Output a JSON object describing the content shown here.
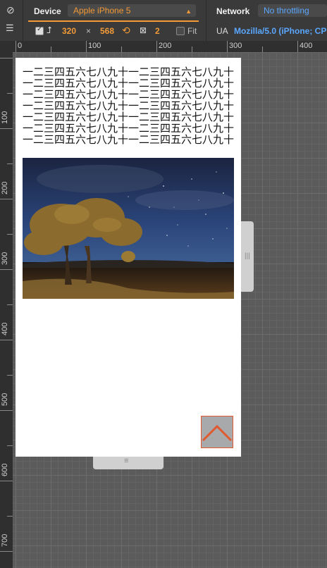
{
  "toolbar": {
    "device_label": "Device",
    "device_value": "Apple iPhone 5",
    "network_label": "Network",
    "network_value": "No throttling",
    "width": "320",
    "times": "×",
    "height": "568",
    "dpr": "2",
    "fit_label": "Fit",
    "ua_label": "UA",
    "ua_value": "Mozilla/5.0 (iPhone; CP"
  },
  "ruler": {
    "top": [
      "0",
      "100",
      "200",
      "300",
      "400"
    ],
    "left": [
      "100",
      "200",
      "300",
      "400",
      "500",
      "600",
      "700"
    ]
  },
  "page": {
    "text_lines": [
      "一二三四五六七八九十一二三四五六七八九十",
      "一二三四五六七八九十一二三四五六七八九十",
      "一二三四五六七八九十一二三四五六七八九十",
      "一二三四五六七八九十一二三四五六七八九十",
      "一二三四五六七八九十一二三四五六七八九十",
      "一二三四五六七八九十一二三四五六七八九十",
      "一二三四五六七八九十一二三四五六七八九十"
    ]
  },
  "colors": {
    "accent": "#f29a36",
    "link": "#5aa7ff",
    "totop_border": "#e2582f"
  },
  "icons": {
    "no_sign": "no-entry-icon",
    "drawer": "drawer-icon",
    "rotate": "rotate-icon",
    "dpr": "pixel-ratio-icon",
    "dims": "dimensions-icon"
  }
}
